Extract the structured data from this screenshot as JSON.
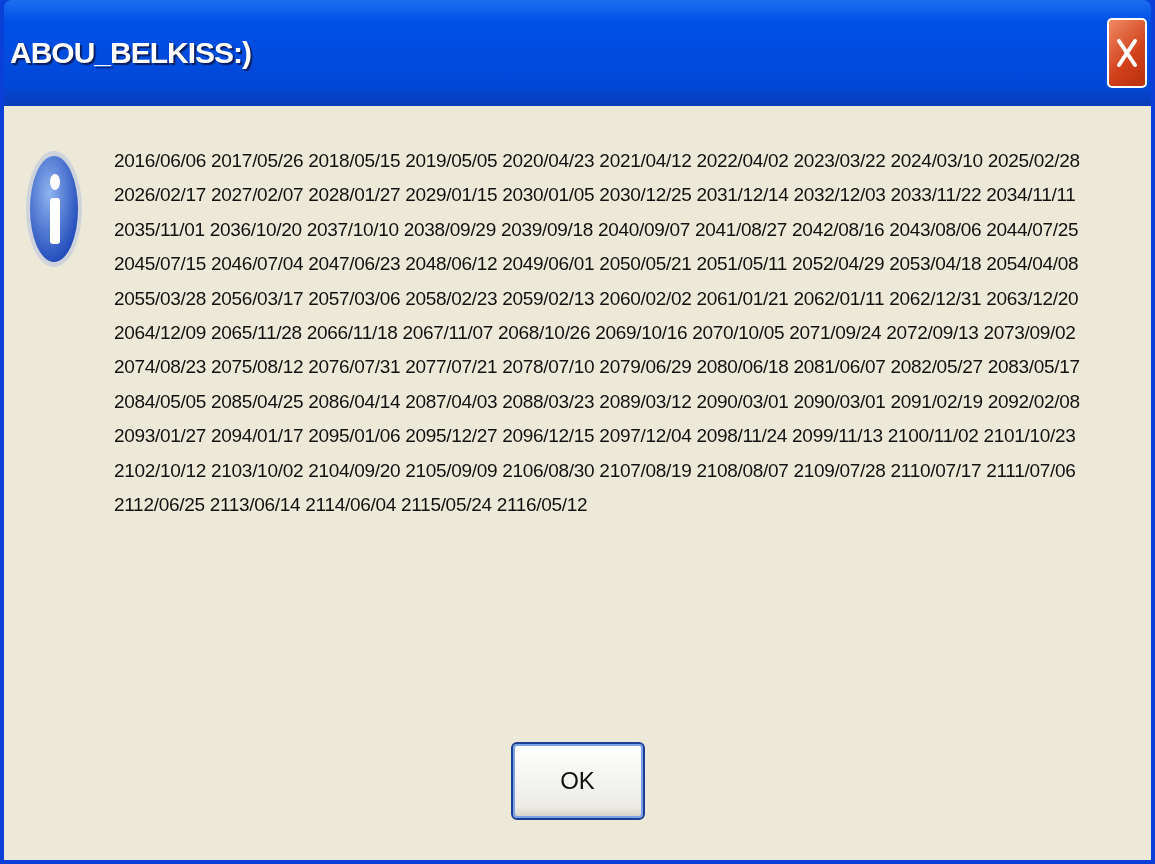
{
  "window": {
    "title": "ABOU_BELKISS:)"
  },
  "message_lines": [
    "2016/06/06 2017/05/26 2018/05/15 2019/05/05 2020/04/23 2021/04/12 2022/04/02 2023/03/22 2024/03/10 2025/02/28",
    "2026/02/17 2027/02/07 2028/01/27 2029/01/15 2030/01/05 2030/12/25 2031/12/14 2032/12/03 2033/11/22 2034/11/11",
    "2035/11/01 2036/10/20 2037/10/10 2038/09/29 2039/09/18 2040/09/07 2041/08/27 2042/08/16 2043/08/06 2044/07/25",
    "2045/07/15 2046/07/04 2047/06/23 2048/06/12 2049/06/01 2050/05/21 2051/05/11 2052/04/29 2053/04/18 2054/04/08",
    "2055/03/28 2056/03/17 2057/03/06 2058/02/23 2059/02/13 2060/02/02 2061/01/21 2062/01/11 2062/12/31 2063/12/20",
    "2064/12/09 2065/11/28 2066/11/18 2067/11/07 2068/10/26 2069/10/16 2070/10/05 2071/09/24 2072/09/13 2073/09/02",
    "2074/08/23 2075/08/12 2076/07/31 2077/07/21 2078/07/10 2079/06/29 2080/06/18 2081/06/07 2082/05/27 2083/05/17",
    "2084/05/05 2085/04/25 2086/04/14 2087/04/03 2088/03/23 2089/03/12 2090/03/01 2090/03/01 2091/02/19 2092/02/08",
    "2093/01/27 2094/01/17 2095/01/06 2095/12/27 2096/12/15 2097/12/04 2098/11/24 2099/11/13 2100/11/02 2101/10/23",
    "2102/10/12 2103/10/02 2104/09/20 2105/09/09 2106/08/30 2107/08/19 2108/08/07 2109/07/28 2110/07/17 2111/07/06",
    "2112/06/25 2113/06/14 2114/06/04 2115/05/24 2116/05/12"
  ],
  "buttons": [
    "OK"
  ]
}
